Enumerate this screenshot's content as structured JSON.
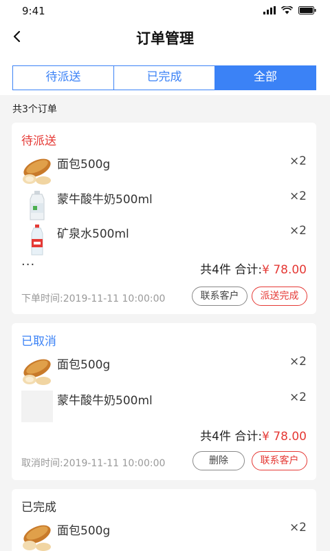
{
  "status_bar": {
    "time": "9:41"
  },
  "nav": {
    "title": "订单管理"
  },
  "tabs": [
    {
      "label": "待派送"
    },
    {
      "label": "已完成"
    },
    {
      "label": "全部"
    }
  ],
  "order_count": "共3个订单",
  "orders": [
    {
      "status": "待派送",
      "status_color": "#e53935",
      "items": [
        {
          "name": "面包500g",
          "qty": "×2",
          "thumb": "bread-image"
        },
        {
          "name": "蒙牛酸牛奶500ml",
          "qty": "×2",
          "thumb": "milk-bottle-image"
        },
        {
          "name": "矿泉水500ml",
          "qty": "×2",
          "thumb": "water-bottle-image"
        }
      ],
      "more": "···",
      "summary_count": "共4件 合计:",
      "summary_price": "¥ 78.00",
      "time": "下单时间:2019-11-11 10:00:00",
      "buttons": [
        "联系客户",
        "派送完成"
      ]
    },
    {
      "status": "已取消",
      "status_color": "#3b82f6",
      "items": [
        {
          "name": "面包500g",
          "qty": "×2",
          "thumb": "bread-image"
        },
        {
          "name": "蒙牛酸牛奶500ml",
          "qty": "×2",
          "thumb": "image-placeholder"
        }
      ],
      "summary_count": "共4件 合计:",
      "summary_price": "¥ 78.00",
      "time": "取消时间:2019-11-11 10:00:00",
      "buttons": [
        "删除",
        "联系客户"
      ]
    },
    {
      "status": "已完成",
      "status_color": "#333333",
      "items": [
        {
          "name": "面包500g",
          "qty": "×2",
          "thumb": "bread-image"
        }
      ]
    }
  ]
}
